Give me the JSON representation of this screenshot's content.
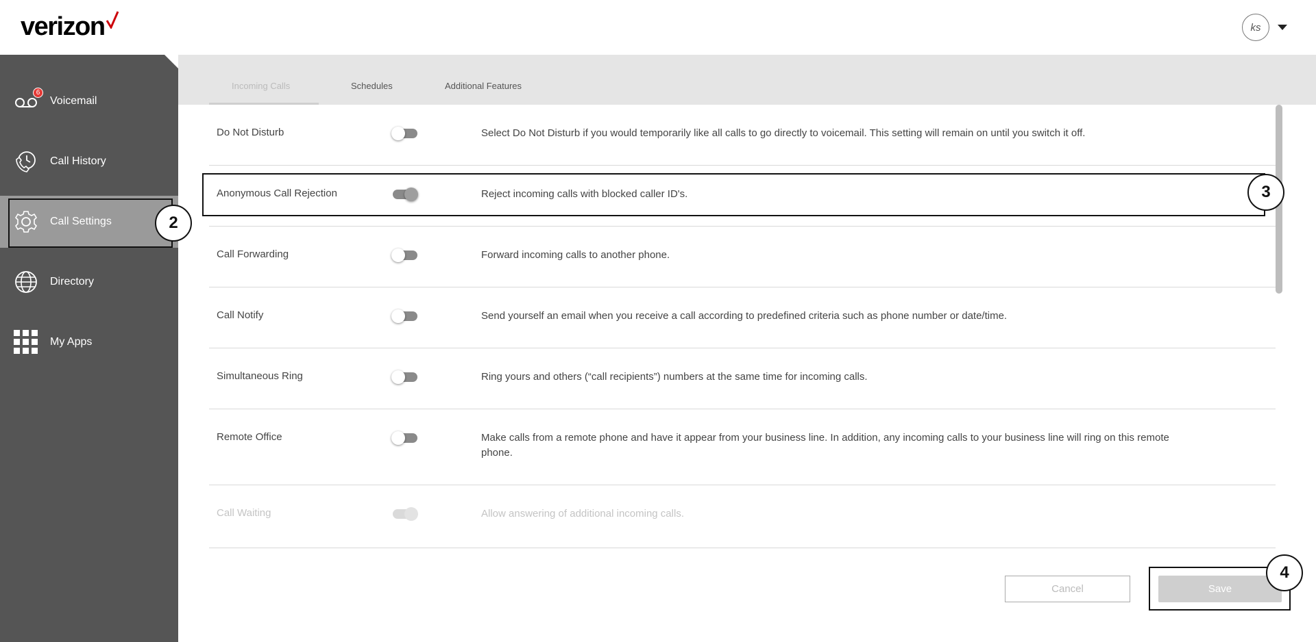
{
  "brand": {
    "logo_text": "verizon",
    "accent_color": "#cd040b"
  },
  "user": {
    "initials": "ks"
  },
  "sidebar": {
    "items": [
      {
        "label": "Voicemail",
        "icon": "voicemail-icon",
        "badge": "6"
      },
      {
        "label": "Call History",
        "icon": "call-history-icon"
      },
      {
        "label": "Call Settings",
        "icon": "gear-icon",
        "active": true
      },
      {
        "label": "Directory",
        "icon": "globe-icon"
      },
      {
        "label": "My Apps",
        "icon": "apps-grid-icon"
      }
    ]
  },
  "tabs": [
    {
      "label": "Incoming Calls",
      "active": true
    },
    {
      "label": "Schedules"
    },
    {
      "label": "Additional Features"
    }
  ],
  "settings": [
    {
      "name": "Do Not Disturb",
      "enabled": false,
      "description": "Select Do Not Disturb if you would temporarily like all calls to go directly to voicemail. This setting will remain on until you switch it off."
    },
    {
      "name": "Anonymous Call Rejection",
      "enabled": true,
      "description": "Reject incoming calls with blocked caller ID's."
    },
    {
      "name": "Call Forwarding",
      "enabled": false,
      "description": "Forward incoming calls to another phone."
    },
    {
      "name": "Call Notify",
      "enabled": false,
      "description": "Send yourself an email when you receive a call according to predefined criteria such as phone number or date/time."
    },
    {
      "name": "Simultaneous Ring",
      "enabled": false,
      "description": "Ring yours and others (“call recipients”) numbers at the same time for incoming calls."
    },
    {
      "name": "Remote Office",
      "enabled": false,
      "description": "Make calls from a remote phone and have it appear from your business line. In addition, any incoming calls to your business line will ring on this remote phone."
    },
    {
      "name": "Call Waiting",
      "enabled": true,
      "disabled": true,
      "description": "Allow answering of additional incoming calls."
    }
  ],
  "actions": {
    "cancel_label": "Cancel",
    "save_label": "Save"
  },
  "callouts": {
    "step2": "2",
    "step3": "3",
    "step4": "4"
  }
}
